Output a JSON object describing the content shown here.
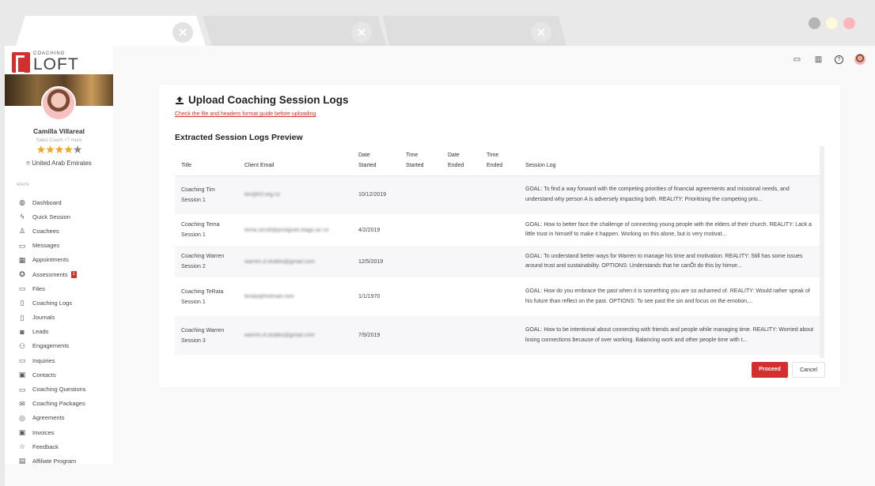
{
  "browser": {
    "tabs": [
      {
        "active": true,
        "close_icon": "×"
      },
      {
        "active": false,
        "close_icon": "×"
      },
      {
        "active": false,
        "close_icon": "×"
      }
    ],
    "window_controls": {
      "colors": [
        "#b5b5b5",
        "#fffad9",
        "#ffb5b9"
      ]
    }
  },
  "brand": {
    "small": "COACHING",
    "big": "LOFT",
    "color": "#d32f2f"
  },
  "profile": {
    "name": "Camilla Villareal",
    "role": "Sales Coach +7 more",
    "rating": 4.5,
    "stars": "★★★★",
    "half_star": "★",
    "location_icon": "⌾",
    "location": "United Arab Emirates"
  },
  "nav": {
    "section": "MAIN",
    "items": [
      {
        "label": "Dashboard",
        "icon": "◍"
      },
      {
        "label": "Quick Session",
        "icon": "ϟ"
      },
      {
        "label": "Coachees",
        "icon": "♙"
      },
      {
        "label": "Messages",
        "icon": "▭"
      },
      {
        "label": "Appointments",
        "icon": "▦"
      },
      {
        "label": "Assessments",
        "icon": "✪",
        "badge": "1"
      },
      {
        "label": "Files",
        "icon": "▭"
      },
      {
        "label": "Coaching Logs",
        "icon": "▯"
      },
      {
        "label": "Journals",
        "icon": "▯"
      },
      {
        "label": "Leads",
        "icon": "◙"
      },
      {
        "label": "Engagements",
        "icon": "⚇"
      },
      {
        "label": "Inquiries",
        "icon": "▭"
      },
      {
        "label": "Contacts",
        "icon": "▣"
      },
      {
        "label": "Coaching Questions",
        "icon": "▭"
      },
      {
        "label": "Coaching Packages",
        "icon": "✉"
      },
      {
        "label": "Agreements",
        "icon": "◎"
      },
      {
        "label": "Invoices",
        "icon": "▣"
      },
      {
        "label": "Feedback",
        "icon": "☆"
      },
      {
        "label": "Affiliate Program",
        "icon": "▤"
      }
    ]
  },
  "header_icons": {
    "messages": "▭",
    "book": "▥",
    "help": "?"
  },
  "page": {
    "title": "Upload Coaching Session Logs",
    "guide_link": "Check the file and headers format guide before uploading",
    "preview_title": "Extracted Session Logs Preview"
  },
  "table": {
    "headers": {
      "title": "Title",
      "client_email": "Client Email",
      "date_started_1": "Date",
      "date_started_2": "Started",
      "time_started_1": "Time",
      "time_started_2": "Started",
      "date_ended_1": "Date",
      "date_ended_2": "Ended",
      "time_ended_1": "Time",
      "time_ended_2": "Ended",
      "session_log": "Session Log"
    },
    "rows": [
      {
        "title1": "Coaching Tim",
        "title2": "Session 1",
        "email": "tim@tcf.org.nz",
        "date_started": "10/12/2019",
        "time_started": "",
        "date_ended": "",
        "time_ended": "",
        "log": "GOAL: To find a way forward with the competing priorities of financial agreements and missional needs, and understand why person A is adversely impacting both. REALITY: Prioritising the competing prio..."
      },
      {
        "title1": "Coaching Tema",
        "title2": "Session 1",
        "email": "tema.stcutt@postgrad.otago.ac.nz",
        "date_started": "4/2/2019",
        "time_started": "",
        "date_ended": "",
        "time_ended": "",
        "log": "GOAL: How to better face the challenge of connecting young people with the elders of their church. REALITY: Lack a little trust in himself to make it happen. Working on this alone, but is very motivat..."
      },
      {
        "title1": "Coaching Warren",
        "title2": "Session 2",
        "email": "warren.d.stubbs@gmail.com",
        "date_started": "12/5/2019",
        "time_started": "",
        "date_ended": "",
        "time_ended": "",
        "log": "GOAL: To understand better ways for Warren to manage his time and motivation. REALITY: Still has some issues around trust and sustainability. OPTIONS: Understands that he canÕt do this by himse..."
      },
      {
        "title1": "Coaching TeRata",
        "title2": "Session 1",
        "email": "terata@hotmail.com",
        "date_started": "1/1/1970",
        "time_started": "",
        "date_ended": "",
        "time_ended": "",
        "log": "GOAL: How do you embrace the past when it is something you are so ashamed of. REALITY: Would rather speak of his future than reflect on the past. OPTIONS: To see past the sin and focus on the emotion,..."
      },
      {
        "title1": "Coaching Warren",
        "title2": "Session 3",
        "email": "warren.d.stubbs@gmail.com",
        "date_started": "7/9/2019",
        "time_started": "",
        "date_ended": "",
        "time_ended": "",
        "log": "GOAL: How to be intentional about connecting with friends and people while managing time. REALITY: Worried about losing connections because of over working. Balancing work and other people time with t..."
      }
    ]
  },
  "actions": {
    "proceed": "Proceed",
    "cancel": "Cancel",
    "accent": "#d32f2f"
  }
}
